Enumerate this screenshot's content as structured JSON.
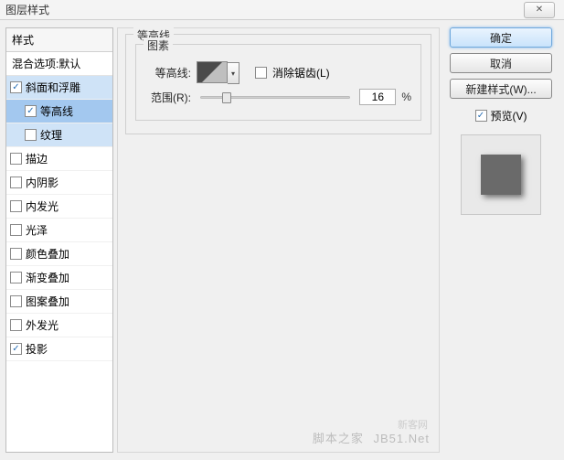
{
  "window": {
    "title": "图层样式"
  },
  "sidebar": {
    "header": "样式",
    "blend": "混合选项:默认",
    "items": [
      {
        "label": "斜面和浮雕",
        "checked": true
      },
      {
        "label": "等高线",
        "checked": true,
        "sub": true
      },
      {
        "label": "纹理",
        "checked": false,
        "sub": true
      },
      {
        "label": "描边",
        "checked": false
      },
      {
        "label": "内阴影",
        "checked": false
      },
      {
        "label": "内发光",
        "checked": false
      },
      {
        "label": "光泽",
        "checked": false
      },
      {
        "label": "颜色叠加",
        "checked": false
      },
      {
        "label": "渐变叠加",
        "checked": false
      },
      {
        "label": "图案叠加",
        "checked": false
      },
      {
        "label": "外发光",
        "checked": false
      },
      {
        "label": "投影",
        "checked": true
      }
    ]
  },
  "main": {
    "group_label": "等高线",
    "elements_label": "图素",
    "contour_label": "等高线:",
    "antialias_label": "消除锯齿(L)",
    "range_label": "范围(R):",
    "range_value": "16",
    "range_unit": "%"
  },
  "right": {
    "ok": "确定",
    "cancel": "取消",
    "new_style": "新建样式(W)...",
    "preview_label": "预览(V)"
  },
  "watermark": {
    "line1": "新客网",
    "line2": "脚本之家",
    "line3": "JB51.Net"
  }
}
